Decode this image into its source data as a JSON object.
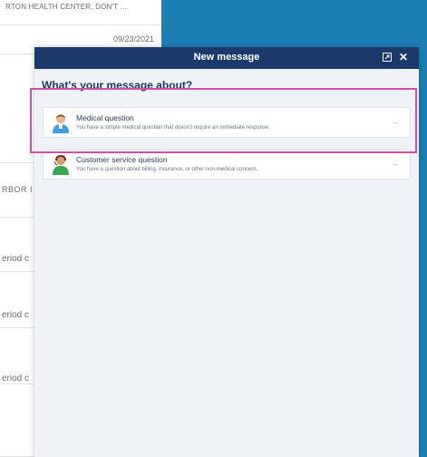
{
  "background": {
    "rows": [
      {
        "text": "RTON HEALTH CENTER, DON'T ..."
      },
      {
        "text": "09/23/2021"
      },
      {
        "text": ""
      },
      {
        "text": "RBOR I"
      },
      {
        "text": "eriod c"
      },
      {
        "text": "eriod c"
      },
      {
        "text": "eriod c"
      },
      {
        "text": ""
      }
    ]
  },
  "modal": {
    "title": "New message",
    "expand_icon": "expand-icon",
    "close_label": "✕",
    "question": "What's your message about?",
    "options": [
      {
        "title": "Medical question",
        "description": "You have a simple medical question that doesn't require an immediate response.",
        "icon": "doctor-avatar-icon",
        "arrow": "→"
      },
      {
        "title": "Customer service question",
        "description": "You have a question about billing, insurance, or other non-medical concern.",
        "icon": "customer-service-avatar-icon",
        "arrow": "→"
      }
    ]
  },
  "colors": {
    "header_bg": "#1b3a6b",
    "modal_bg": "#eff2f7",
    "app_blue": "#1c7fb3",
    "highlight": "#d14fa6"
  }
}
